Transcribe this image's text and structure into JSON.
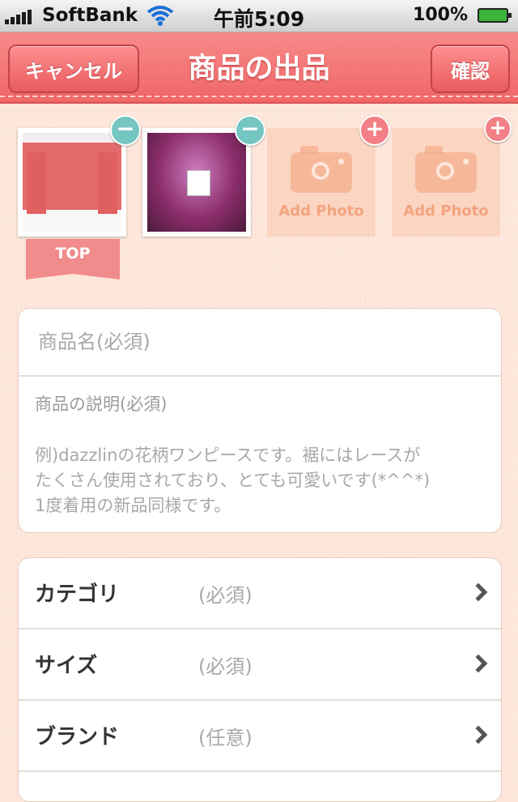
{
  "status_bar": {
    "carrier": "SoftBank",
    "time": "午前5:09",
    "battery": "100%"
  },
  "nav": {
    "cancel_label": "キャンセル",
    "title": "商品の出品",
    "confirm_label": "確認"
  },
  "photos": {
    "add_label_1": "Add Photo",
    "add_label_2": "Add Photo",
    "top_label": "TOP",
    "remove_symbol": "−",
    "add_symbol": "+"
  },
  "form": {
    "name_placeholder": "商品名(必須)",
    "description_placeholder": "商品の説明(必須)",
    "description_example": "例)dazzlinの花柄ワンピースです。裾にはレースが\nたくさん使用されており、とても可愛いです(*^^*)\n1度着用の新品同様です。"
  },
  "rows": [
    {
      "label": "カテゴリ",
      "value": "(必須)"
    },
    {
      "label": "サイズ",
      "value": "(必須)"
    },
    {
      "label": "ブランド",
      "value": "(任意)"
    }
  ],
  "colors": {
    "nav": "#ef6666",
    "background": "#fde7da",
    "minus_badge": "#75c5c3",
    "plus_badge": "#f38086"
  }
}
